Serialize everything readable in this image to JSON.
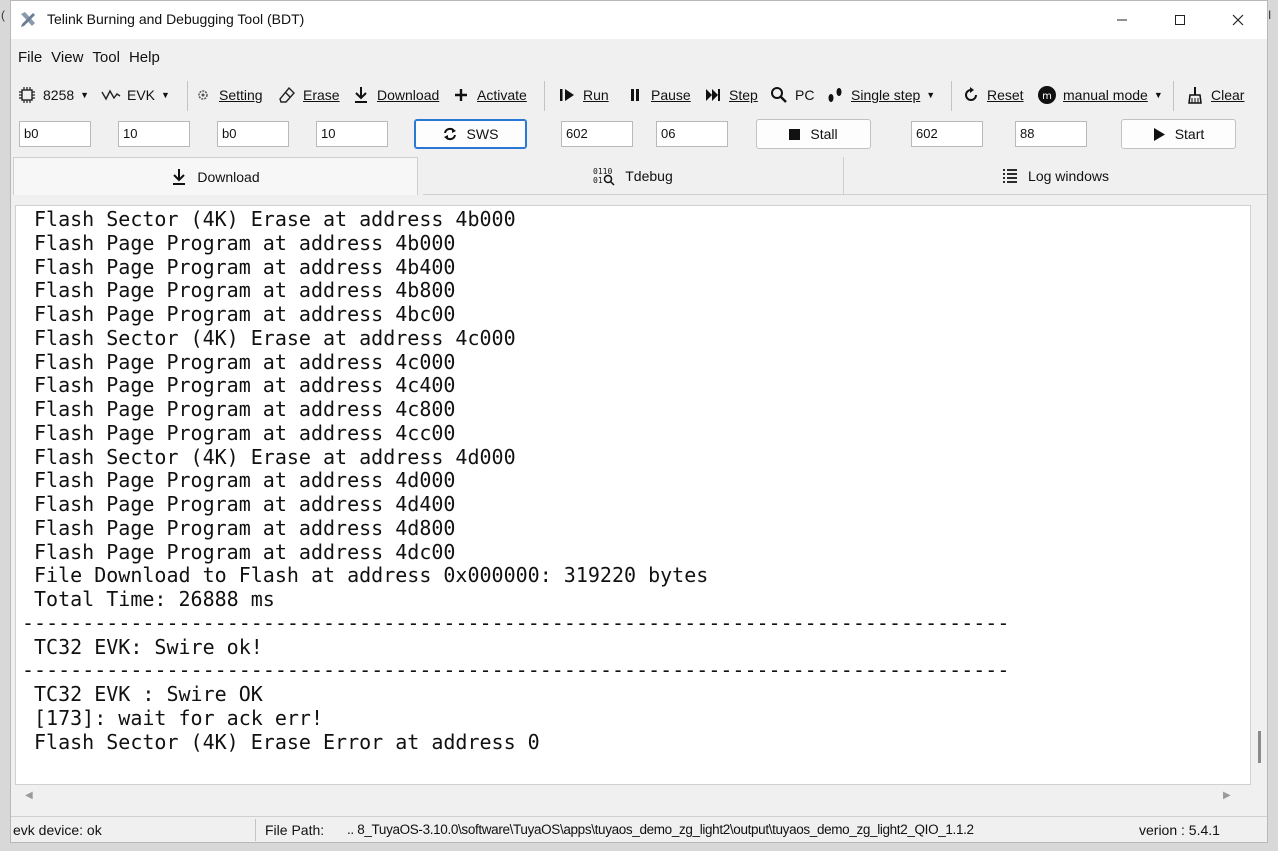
{
  "window": {
    "title": "Telink Burning and Debugging Tool (BDT)",
    "minimize_glyph": "—",
    "maximize_glyph": "☐",
    "close_glyph": "✕"
  },
  "menu": [
    "File",
    "View",
    "Tool",
    "Help"
  ],
  "toolbar": {
    "chip": "8258",
    "board": "EVK",
    "setting": "Setting",
    "erase": "Erase",
    "download": "Download",
    "activate": "Activate",
    "run": "Run",
    "pause": "Pause",
    "step": "Step",
    "pc": "PC",
    "single_step": "Single step",
    "reset": "Reset",
    "mode": "manual mode",
    "clear": "Clear"
  },
  "inputs": {
    "f1": "b0",
    "f2": "10",
    "f3": "b0",
    "f4": "10",
    "sws": "SWS",
    "f5": "602",
    "f6": "06",
    "stall": "Stall",
    "f7": "602",
    "f8": "88",
    "start": "Start"
  },
  "tabs": [
    "Download",
    "Tdebug",
    "Log windows"
  ],
  "log": [
    "Flash Sector (4K) Erase at address 4b000",
    "Flash Page Program at address 4b000",
    "Flash Page Program at address 4b400",
    "Flash Page Program at address 4b800",
    "Flash Page Program at address 4bc00",
    "Flash Sector (4K) Erase at address 4c000",
    "Flash Page Program at address 4c000",
    "Flash Page Program at address 4c400",
    "Flash Page Program at address 4c800",
    "Flash Page Program at address 4cc00",
    "Flash Sector (4K) Erase at address 4d000",
    "Flash Page Program at address 4d000",
    "Flash Page Program at address 4d400",
    "Flash Page Program at address 4d800",
    "Flash Page Program at address 4dc00",
    "File Download to Flash at address 0x000000: 319220 bytes",
    "Total Time: 26888 ms",
    "----------------------------------------------------------------------------------",
    "TC32 EVK: Swire ok!",
    "----------------------------------------------------------------------------------",
    "TC32 EVK : Swire OK",
    "[173]: wait for ack err!",
    "Flash Sector (4K) Erase Error at address 0"
  ],
  "status": {
    "device": "evk device: ok",
    "file_path_label": "File Path:",
    "file_path": "..  8_TuyaOS-3.10.0\\software\\TuyaOS\\apps\\tuyaos_demo_zg_light2\\output\\tuyaos_demo_zg_light2_QIO_1.1.2",
    "version": "verion : 5.4.1"
  },
  "colors": {
    "accent": "#2a78d6",
    "background": "#f0f0f0",
    "log_bg": "#ffffff"
  }
}
